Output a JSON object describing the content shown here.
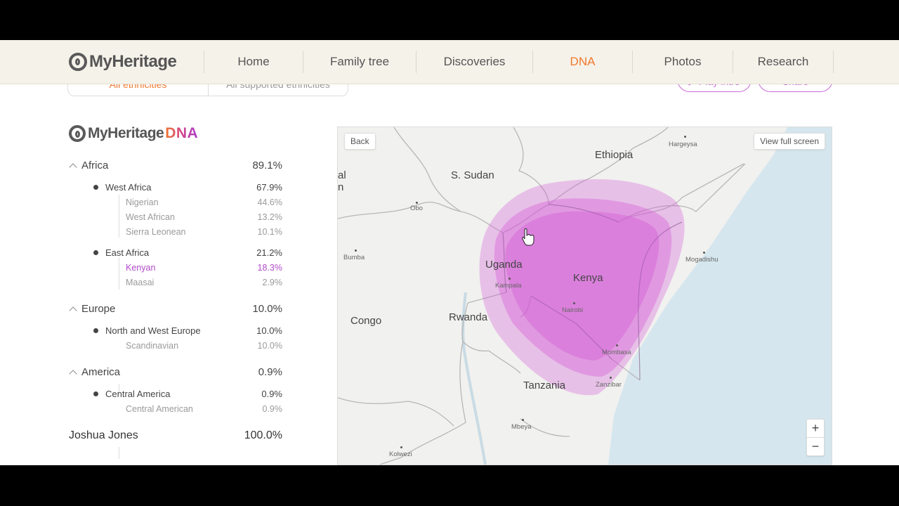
{
  "header": {
    "logo_text": "MyHeritage",
    "nav": [
      {
        "label": "Home",
        "active": false
      },
      {
        "label": "Family tree",
        "active": false
      },
      {
        "label": "Discoveries",
        "active": false
      },
      {
        "label": "DNA",
        "active": true
      },
      {
        "label": "Photos",
        "active": false
      },
      {
        "label": "Research",
        "active": false
      }
    ]
  },
  "toolbar": {
    "seg_active": "All ethnicities",
    "seg_other": "All supported ethnicities",
    "play_intro": "Play intro",
    "share": "Share"
  },
  "dna_logo": {
    "brand": "MyHeritage",
    "dna": "DNA"
  },
  "ethnicity": {
    "regions": [
      {
        "name": "Africa",
        "pct": "89.1%"
      },
      {
        "name": "Europe",
        "pct": "10.0%"
      },
      {
        "name": "America",
        "pct": "0.9%"
      }
    ],
    "subregions": [
      {
        "name": "West Africa",
        "pct": "67.9%"
      },
      {
        "name": "East Africa",
        "pct": "21.2%"
      },
      {
        "name": "North and West Europe",
        "pct": "10.0%"
      },
      {
        "name": "Central America",
        "pct": "0.9%"
      }
    ],
    "leaves": [
      {
        "name": "Nigerian",
        "pct": "44.6%"
      },
      {
        "name": "West African",
        "pct": "13.2%"
      },
      {
        "name": "Sierra Leonean",
        "pct": "10.1%"
      },
      {
        "name": "Kenyan",
        "pct": "18.3%"
      },
      {
        "name": "Maasai",
        "pct": "2.9%"
      },
      {
        "name": "Scandinavian",
        "pct": "10.0%"
      },
      {
        "name": "Central American",
        "pct": "0.9%"
      }
    ],
    "total": {
      "name": "Joshua Jones",
      "pct": "100.0%"
    }
  },
  "map": {
    "back": "Back",
    "fullscreen": "View full screen",
    "zoom_in": "+",
    "zoom_out": "−",
    "countries": [
      "Ethiopia",
      "S. Sudan",
      "Uganda",
      "Kenya",
      "Congo",
      "Rwanda",
      "Tanzania"
    ],
    "edge_labels": [
      "al",
      "n"
    ],
    "cities": [
      "Hargeysa",
      "Obo",
      "Bumba",
      "Kampala",
      "Nairobi",
      "Mogadishu",
      "Mombasa",
      "Zanzibar",
      "Mbeya",
      "Kolwezi"
    ],
    "colors": {
      "land": "#f1f1ef",
      "water": "#d5e6ee",
      "borders": "#b7b7b7",
      "region": "#d45ad6"
    }
  }
}
